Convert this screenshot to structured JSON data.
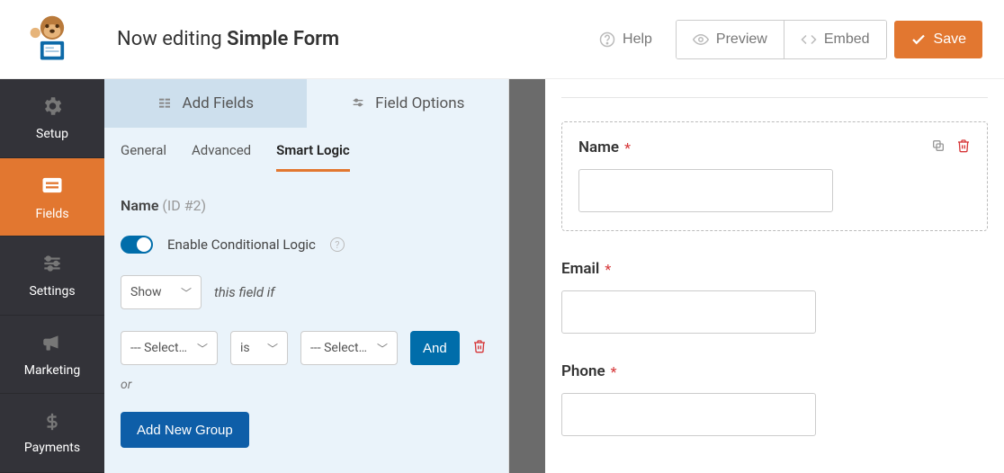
{
  "colors": {
    "accent": "#e27730",
    "blue": "#006daa",
    "danger": "#d63638"
  },
  "header": {
    "title_prefix": "Now editing ",
    "title_name": "Simple Form",
    "help": "Help",
    "preview": "Preview",
    "embed": "Embed",
    "save": "Save"
  },
  "sidebar": {
    "items": [
      {
        "label": "Setup"
      },
      {
        "label": "Fields"
      },
      {
        "label": "Settings"
      },
      {
        "label": "Marketing"
      },
      {
        "label": "Payments"
      }
    ],
    "active": 1
  },
  "panel": {
    "tabs": {
      "add": "Add Fields",
      "options": "Field Options"
    },
    "active_tab": "options",
    "subtabs": [
      "General",
      "Advanced",
      "Smart Logic"
    ],
    "active_subtab": 2,
    "field_name": "Name",
    "field_id": "(ID #2)",
    "toggle_label": "Enable Conditional Logic",
    "toggle_on": true,
    "action_select": "Show",
    "condition_text": "this field if",
    "rule_field_select": "--- Select Field ---",
    "rule_op_select": "is",
    "rule_value_select": "--- Select Choice ---",
    "and_label": "And",
    "or_label": "or",
    "add_group_label": "Add New Group"
  },
  "preview": {
    "fields": [
      {
        "label": "Name",
        "required": true,
        "selected": true
      },
      {
        "label": "Email",
        "required": true,
        "selected": false
      },
      {
        "label": "Phone",
        "required": true,
        "selected": false
      }
    ]
  }
}
